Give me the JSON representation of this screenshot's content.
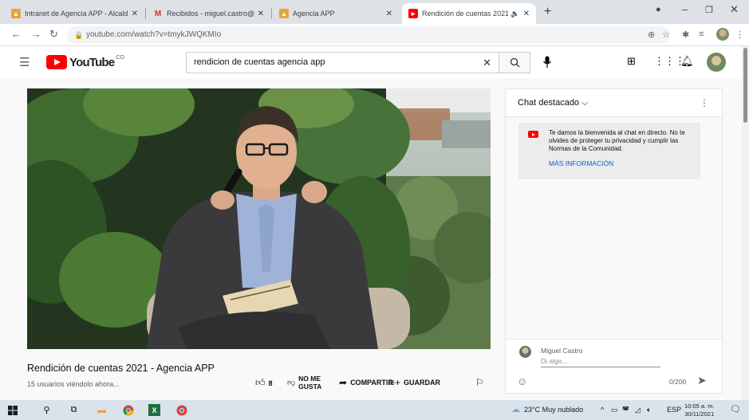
{
  "browser": {
    "tabs": [
      {
        "title": "Intranet de Agencia APP - Alcald",
        "icon": "agency-icon",
        "active": false
      },
      {
        "title": "Recibidos - miguel.castro@app.g",
        "icon": "gmail-icon",
        "active": false
      },
      {
        "title": "Agencia APP",
        "icon": "agency-icon",
        "active": false
      },
      {
        "title": "Rendición de cuentas 2021 -",
        "icon": "youtube-icon",
        "active": true
      }
    ],
    "close_glyph": "✕",
    "new_tab_glyph": "+",
    "url": "youtube.com/watch?v=tmykJWQKMIo"
  },
  "youtube": {
    "logo_text": "YouTube",
    "logo_suffix": "CO",
    "search_query": "rendicion de cuentas agencia app",
    "clear_glyph": "✕"
  },
  "video": {
    "title": "Rendición de cuentas 2021 - Agencia APP",
    "viewers": "15 usuarios viéndolo ahora...",
    "like_count": "8",
    "dislike_label_1": "NO ME",
    "dislike_label_2": "GUSTA",
    "share_label": "COMPARTIR",
    "save_label": "GUARDAR"
  },
  "chat": {
    "header": "Chat destacado",
    "welcome_text": "Te damos la bienvenida al chat en directo. No te olvides de proteger tu privacidad y cumplir las Normas de la Comunidad.",
    "more_info": "MÁS INFORMACIÓN",
    "user_name": "Miguel Castro",
    "input_placeholder": "Di algo...",
    "char_count": "0/200"
  },
  "taskbar": {
    "weather": "23°C  Muy nublado",
    "language": "ESP",
    "time": "10:05 a. m.",
    "date": "30/11/2021"
  },
  "colors": {
    "youtube_red": "#ff0000",
    "link_blue": "#065fd4",
    "tabstrip": "#dee1e6",
    "taskbar": "#d9e3ec"
  }
}
